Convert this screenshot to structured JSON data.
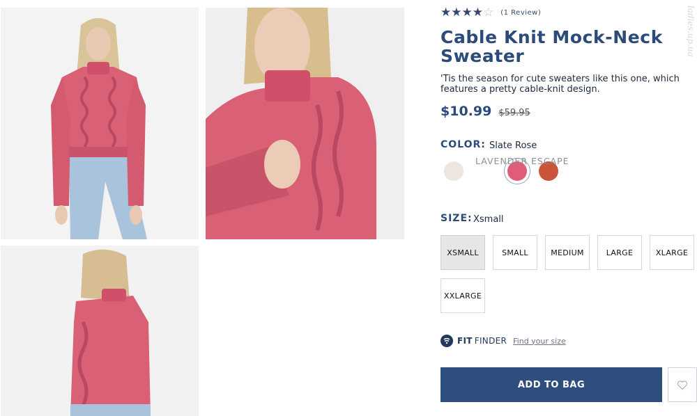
{
  "gallery": {
    "images": [
      {
        "alt": "front view"
      },
      {
        "alt": "close-up view"
      },
      {
        "alt": "back view"
      }
    ]
  },
  "product": {
    "rating": {
      "stars": 4,
      "max": 5,
      "review_count": "(1 Review)"
    },
    "title": "Cable Knit Mock-Neck Sweater",
    "description": "'Tis the season for cute sweaters like this one, which features a pretty cable-knit design.",
    "price": {
      "sale": "$10.99",
      "original": "$59.95"
    }
  },
  "color": {
    "label": "COLOR:",
    "selected": "Slate Rose",
    "hover_name": "LAVENDER ESCAPE",
    "swatches": [
      {
        "color": "#ece6de"
      },
      {
        "color": "#e05c78"
      },
      {
        "color": "#c9553a"
      }
    ]
  },
  "size": {
    "label": "SIZE:",
    "selected": "Xsmall",
    "options": [
      "XSMALL",
      "SMALL",
      "MEDIUM",
      "LARGE",
      "XLARGE",
      "XXLARGE"
    ]
  },
  "fit_finder": {
    "fit": "FIT",
    "finder": "FINDER",
    "link": "Find your size"
  },
  "actions": {
    "add_to_bag": "ADD TO BAG",
    "wishlist_icon": "heart-icon"
  },
  "colors": {
    "brand": "#2e4f7d",
    "title": "#2c4b7a",
    "sweater": "#d96075"
  },
  "watermark": "ladies.up.ua"
}
